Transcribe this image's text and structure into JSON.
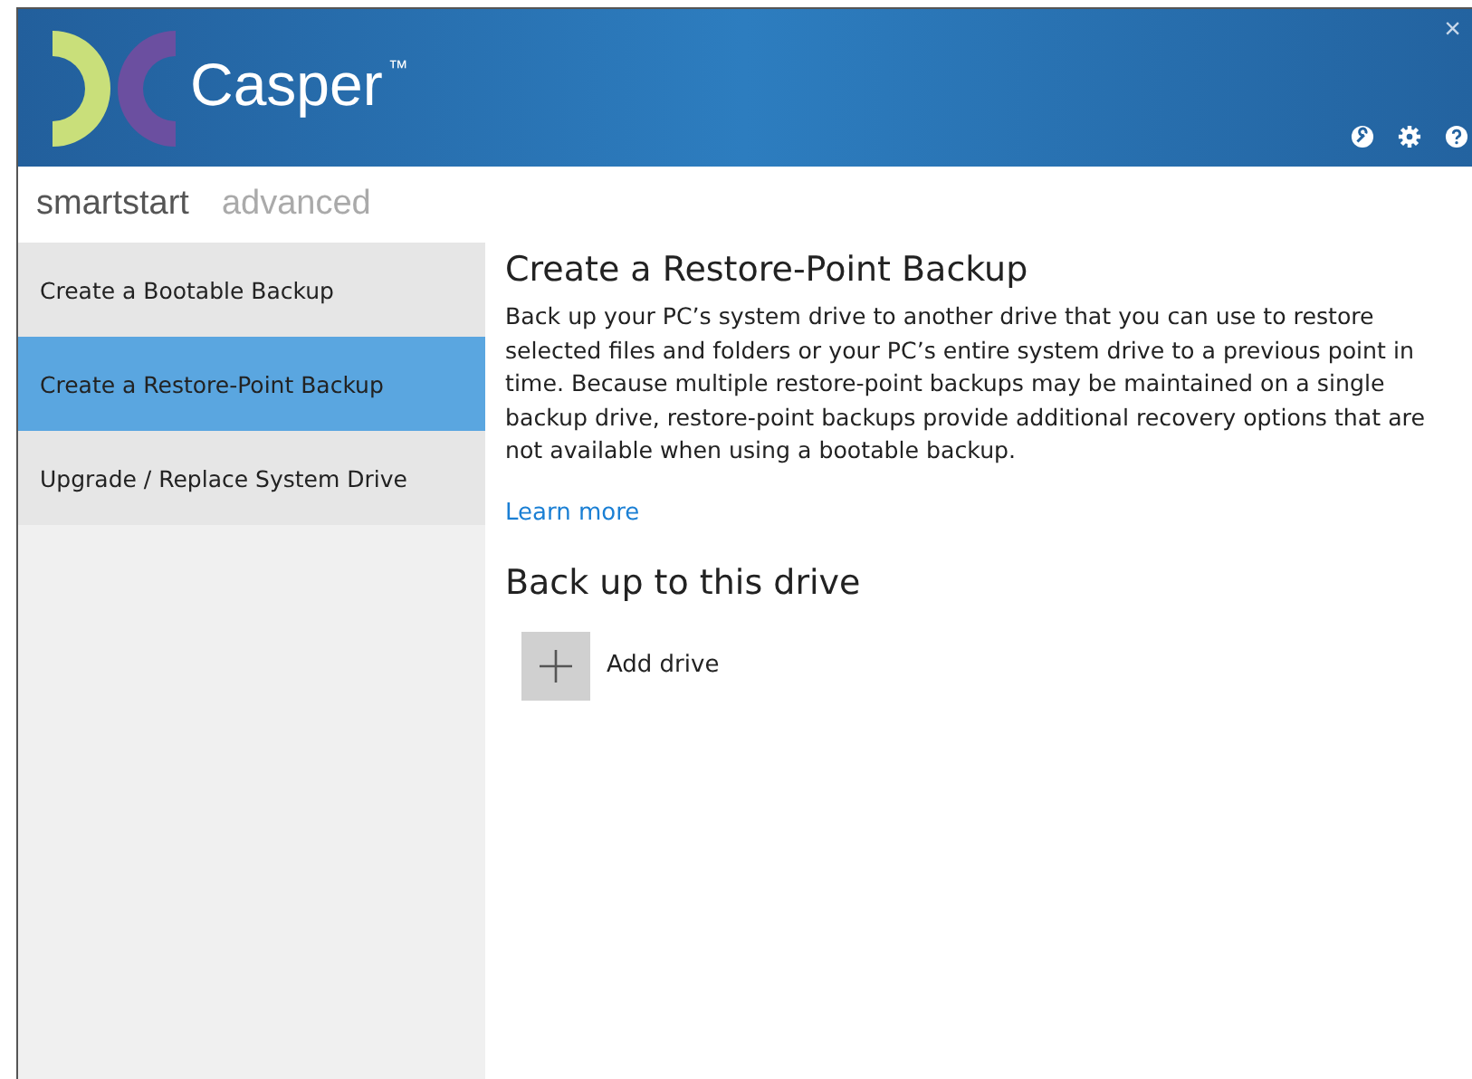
{
  "header": {
    "app_name": "Casper$^{™}$",
    "close": "×"
  },
  "tabs": [
    {
      "label": "smartstart",
      "selected": true
    },
    {
      "label": "advanced",
      "selected": false
    }
  ],
  "sidebar": {
    "items": [
      {
        "label": "Create a Bootable Backup",
        "selected": false
      },
      {
        "label": "Create a Restore-Point Backup",
        "selected": true
      },
      {
        "label": "Upgrade / Replace System Drive",
        "selected": false
      }
    ]
  },
  "content": {
    "title": "Create a Restore-Point Backup",
    "description": "Back up your PC’s system drive to another drive that you can use to restore selected files and folders or your PC’s entire system drive to a previous point in time. Because multiple restore-point backups may be maintained on a single backup drive, restore-point backups provide additional recovery options that are not available when using a bootable backup.",
    "link": "Learn more",
    "section_title": "Back up to this drive",
    "add_button": "Add drive"
  }
}
